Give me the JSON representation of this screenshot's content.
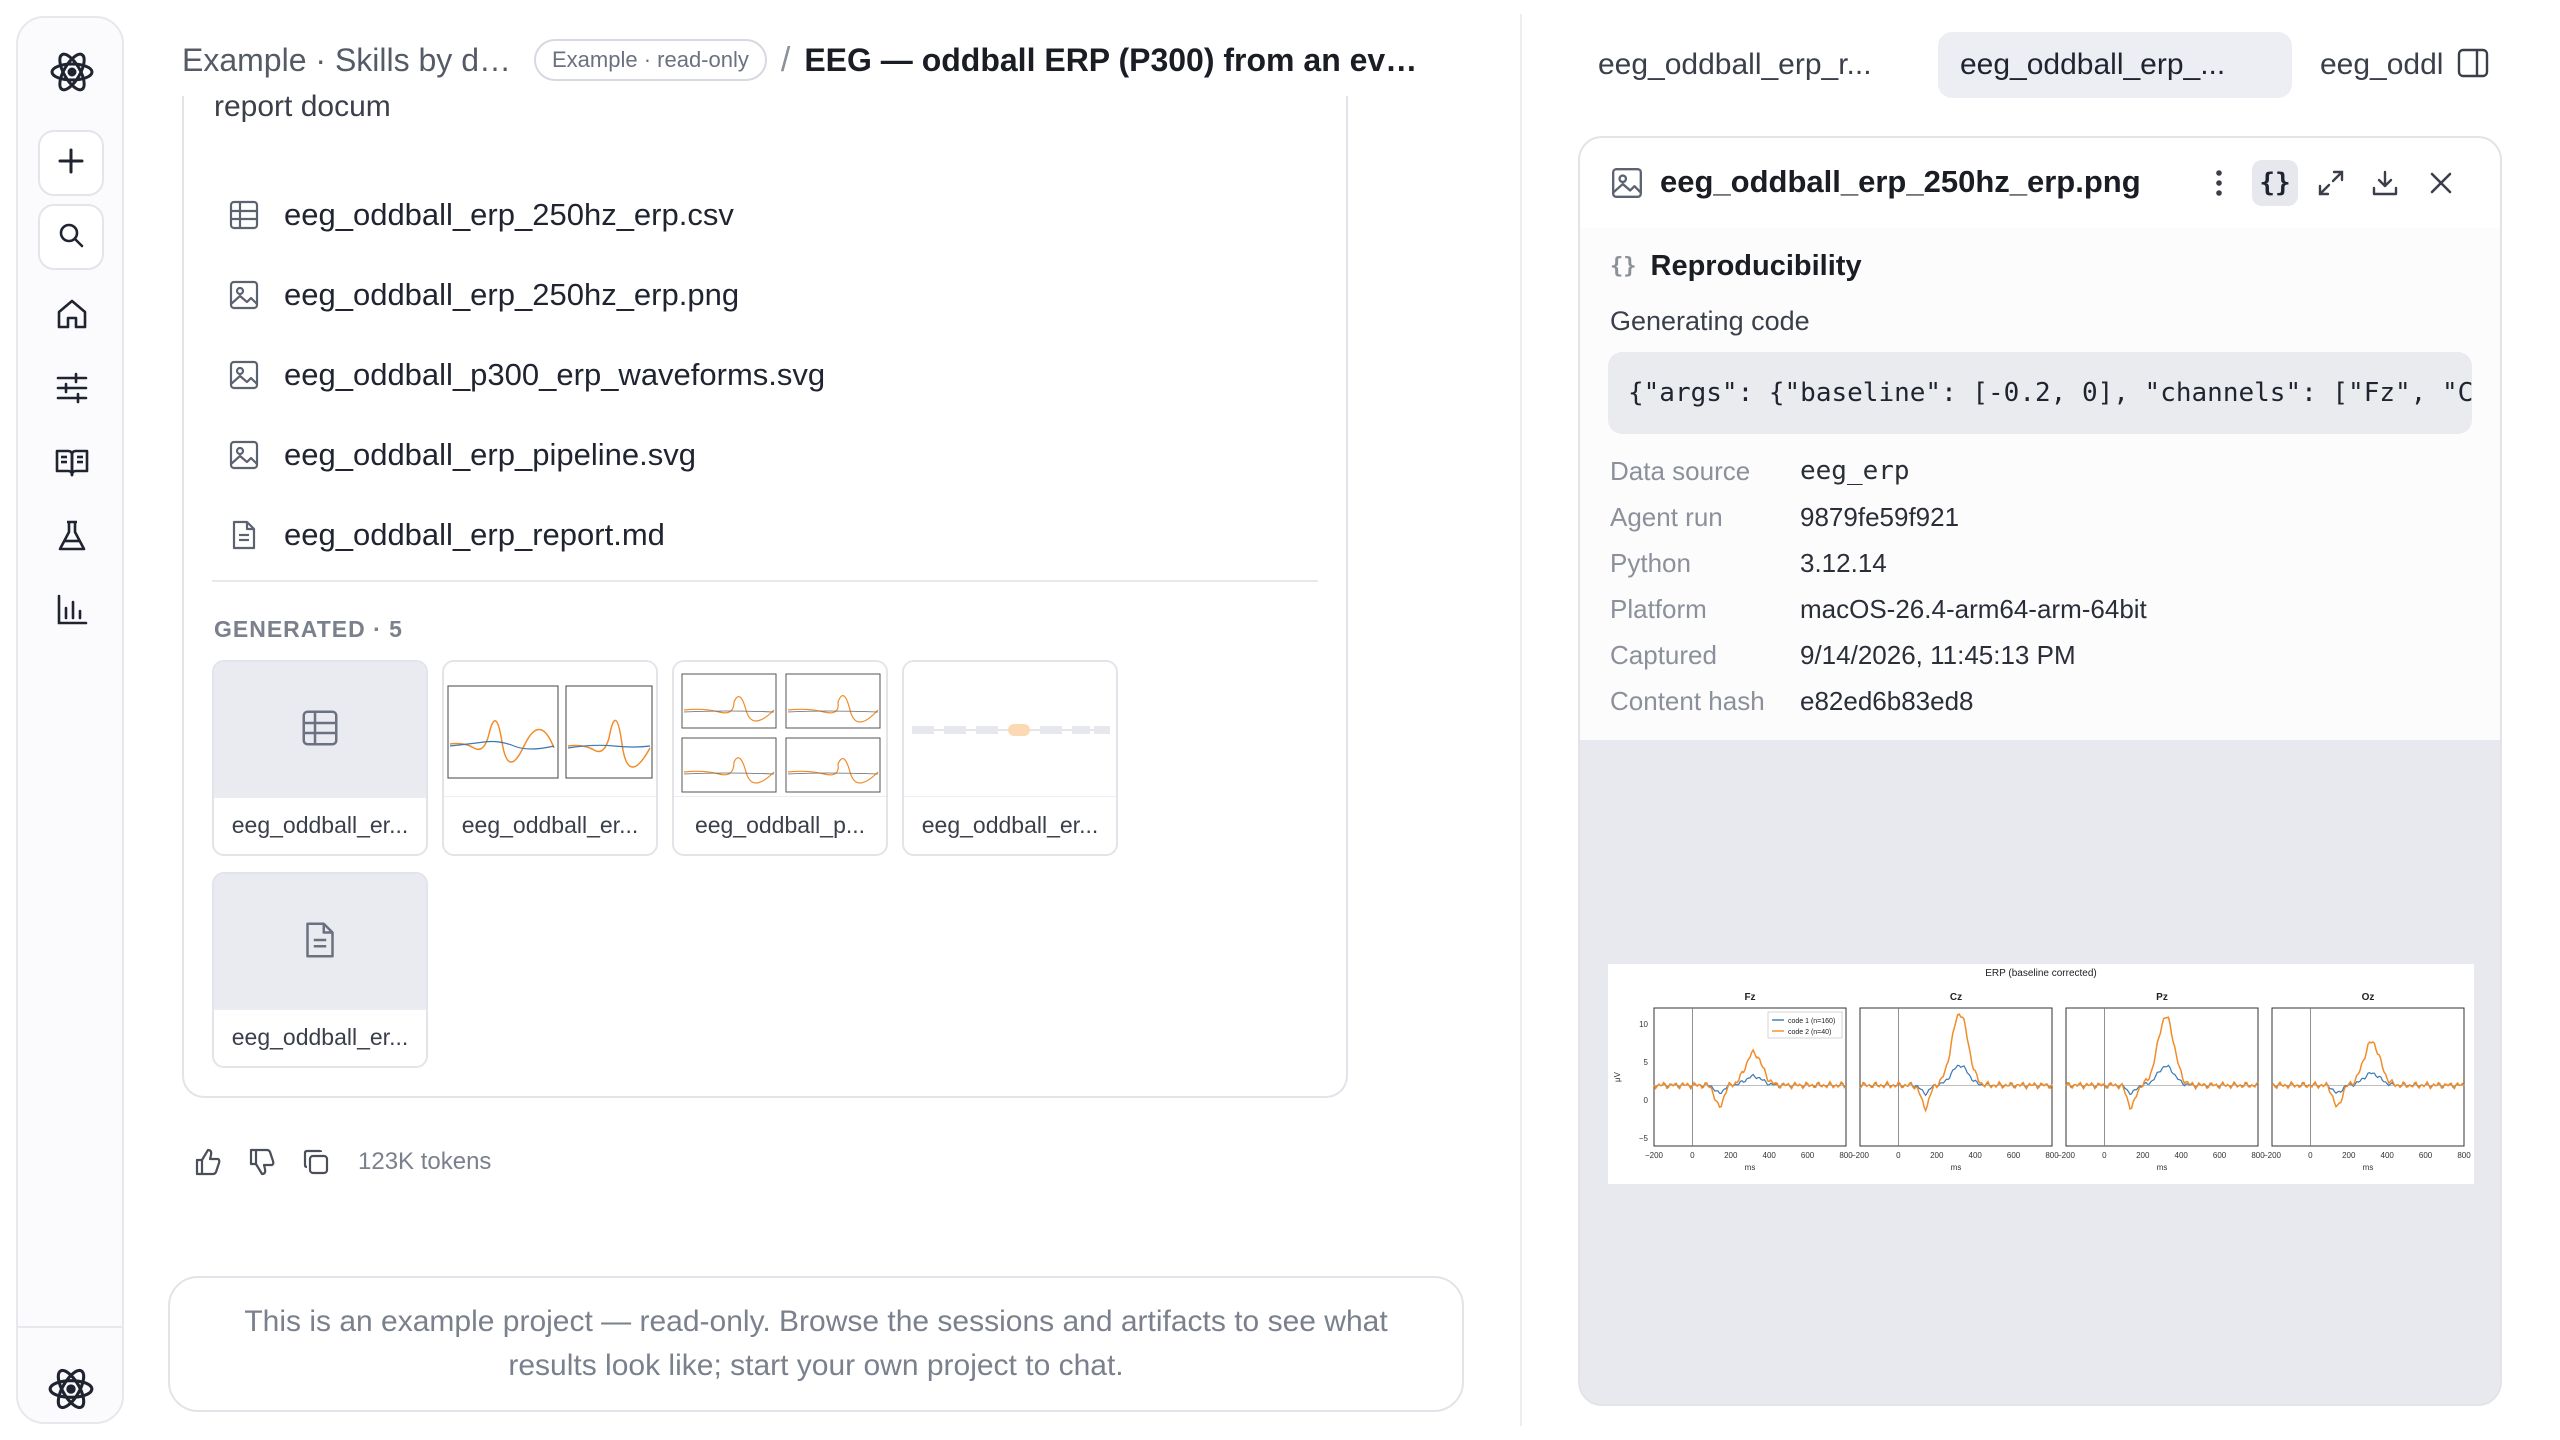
{
  "header": {
    "crumb_project": "Example · Skills by do...",
    "badge": "Example · read-only",
    "separator": "/",
    "title": "EEG — oddball ERP (P300) from an eve..."
  },
  "rail": {
    "icons": [
      "app-logo-icon",
      "new-icon",
      "search-icon",
      "home-icon",
      "sliders-icon",
      "book-icon",
      "flask-icon",
      "chart-icon",
      "app-logo-icon"
    ]
  },
  "main": {
    "doc_text": "report docum",
    "files": [
      {
        "name": "eeg_oddball_erp_250hz_erp.csv",
        "icon": "table-icon"
      },
      {
        "name": "eeg_oddball_erp_250hz_erp.png",
        "icon": "image-icon"
      },
      {
        "name": "eeg_oddball_p300_erp_waveforms.svg",
        "icon": "image-icon"
      },
      {
        "name": "eeg_oddball_erp_pipeline.svg",
        "icon": "image-icon"
      },
      {
        "name": "eeg_oddball_erp_report.md",
        "icon": "document-icon"
      }
    ],
    "generated_label": "GENERATED · 5",
    "thumbnails": [
      {
        "label": "eeg_oddball_er..."
      },
      {
        "label": "eeg_oddball_er..."
      },
      {
        "label": "eeg_oddball_p..."
      },
      {
        "label": "eeg_oddball_er..."
      },
      {
        "label": "eeg_oddball_er..."
      }
    ],
    "tokens": "123K tokens",
    "notice": "This is an example project — read-only. Browse the sessions and artifacts to see what results look like; start your own project to chat."
  },
  "right": {
    "tabs": [
      "eeg_oddball_erp_r...",
      "eeg_oddball_erp_...",
      "eeg_oddl"
    ],
    "viewer_title": "eeg_oddball_erp_250hz_erp.png",
    "reproducibility": "Reproducibility",
    "generating_code_label": "Generating code",
    "code": "{\"args\": {\"baseline\": [-0.2, 0], \"channels\": [\"Fz\", \"C",
    "meta": [
      {
        "k": "Data source",
        "v": "eeg_erp"
      },
      {
        "k": "Agent run",
        "v": "9879fe59f921"
      },
      {
        "k": "Python",
        "v": "3.12.14"
      },
      {
        "k": "Platform",
        "v": "macOS-26.4-arm64-arm-64bit"
      },
      {
        "k": "Captured",
        "v": "9/14/2026, 11:45:13 PM"
      },
      {
        "k": "Content hash",
        "v": "e82ed6b83ed8"
      }
    ],
    "plot": {
      "title": "ERP (baseline corrected)",
      "panels": [
        "Fz",
        "Cz",
        "Pz",
        "Oz"
      ],
      "legend": [
        "code 1 (n=160)",
        "code 2 (n=40)"
      ],
      "ylabel": "μV",
      "xlabel": "ms",
      "yticks": [
        "10",
        "5",
        "0",
        "−5"
      ],
      "xticks": [
        "−200",
        "0",
        "200",
        "400",
        "600",
        "800"
      ]
    }
  }
}
